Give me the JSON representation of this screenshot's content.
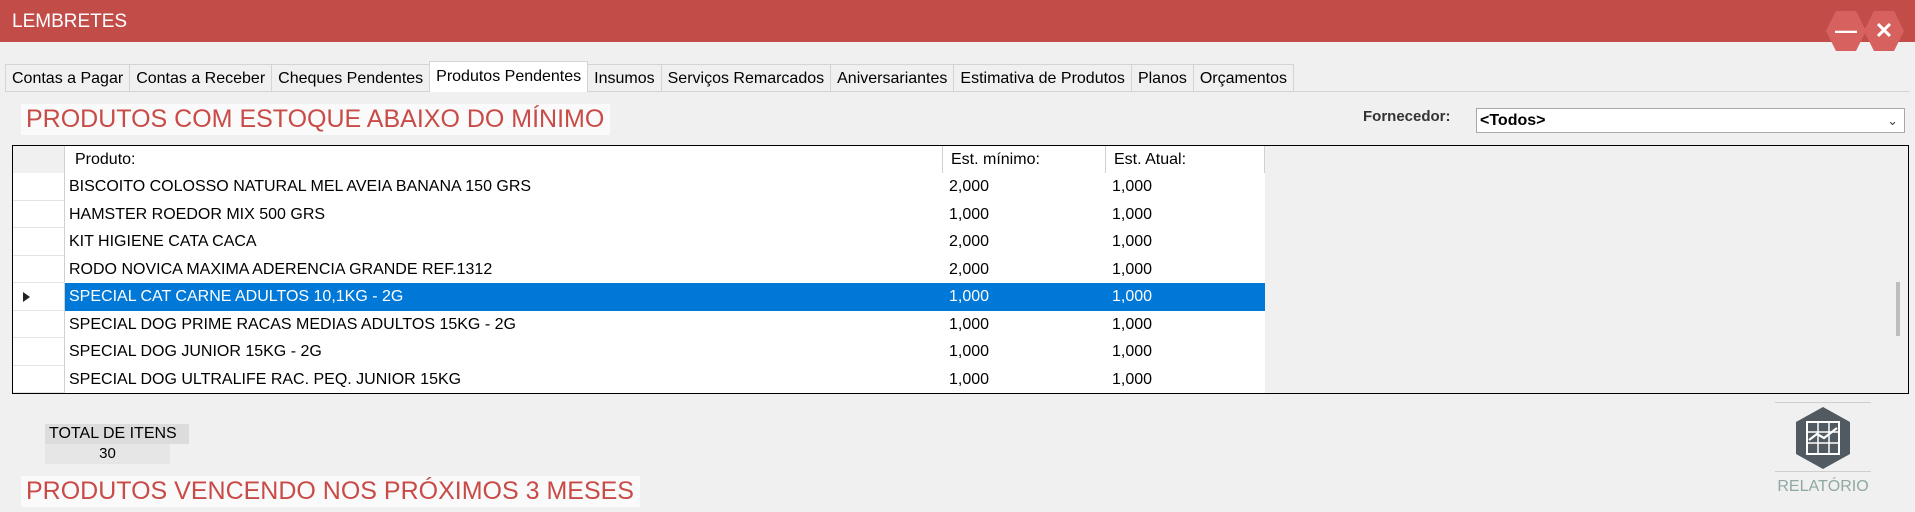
{
  "window": {
    "title": "LEMBRETES",
    "minimize_glyph": "—",
    "close_glyph": "✕",
    "accent_color": "#c24c48"
  },
  "tabs": [
    {
      "label": "Contas a Pagar",
      "active": false
    },
    {
      "label": "Contas a Receber",
      "active": false
    },
    {
      "label": "Cheques Pendentes",
      "active": false
    },
    {
      "label": "Produtos Pendentes",
      "active": true
    },
    {
      "label": "Insumos",
      "active": false
    },
    {
      "label": "Serviços Remarcados",
      "active": false
    },
    {
      "label": "Aniversariantes",
      "active": false
    },
    {
      "label": "Estimativa de Produtos",
      "active": false
    },
    {
      "label": "Planos",
      "active": false
    },
    {
      "label": "Orçamentos",
      "active": false
    }
  ],
  "low_stock": {
    "title": "PRODUTOS COM ESTOQUE ABAIXO DO MÍNIMO",
    "supplier": {
      "label": "Fornecedor:",
      "selected": "<Todos>"
    },
    "columns": {
      "produto": "Produto:",
      "min": "Est. mínimo:",
      "atual": "Est. Atual:"
    },
    "rows": [
      {
        "produto": "BISCOITO COLOSSO NATURAL MEL AVEIA BANANA 150 GRS",
        "min": "2,000",
        "atual": "1,000"
      },
      {
        "produto": "HAMSTER ROEDOR MIX 500 GRS",
        "min": "1,000",
        "atual": "1,000"
      },
      {
        "produto": "KIT HIGIENE CATA CACA",
        "min": "2,000",
        "atual": "1,000"
      },
      {
        "produto": "RODO NOVICA MAXIMA ADERENCIA GRANDE REF.1312",
        "min": "2,000",
        "atual": "1,000"
      },
      {
        "produto": "SPECIAL CAT CARNE ADULTOS 10,1KG - 2G",
        "min": "1,000",
        "atual": "1,000"
      },
      {
        "produto": "SPECIAL DOG PRIME RACAS MEDIAS ADULTOS 15KG - 2G",
        "min": "1,000",
        "atual": "1,000"
      },
      {
        "produto": "SPECIAL DOG JUNIOR 15KG - 2G",
        "min": "1,000",
        "atual": "1,000"
      },
      {
        "produto": "SPECIAL DOG ULTRALIFE RAC. PEQ. JUNIOR 15KG",
        "min": "1,000",
        "atual": "1,000"
      }
    ],
    "selected_row": 4,
    "selection_color": "#0078d7",
    "total": {
      "label": "TOTAL DE ITENS",
      "value": "30"
    }
  },
  "report": {
    "label": "RELATÓRIO",
    "icon": "report-chart-icon"
  },
  "expiring": {
    "title": "PRODUTOS VENCENDO NOS PRÓXIMOS 3 MESES"
  }
}
